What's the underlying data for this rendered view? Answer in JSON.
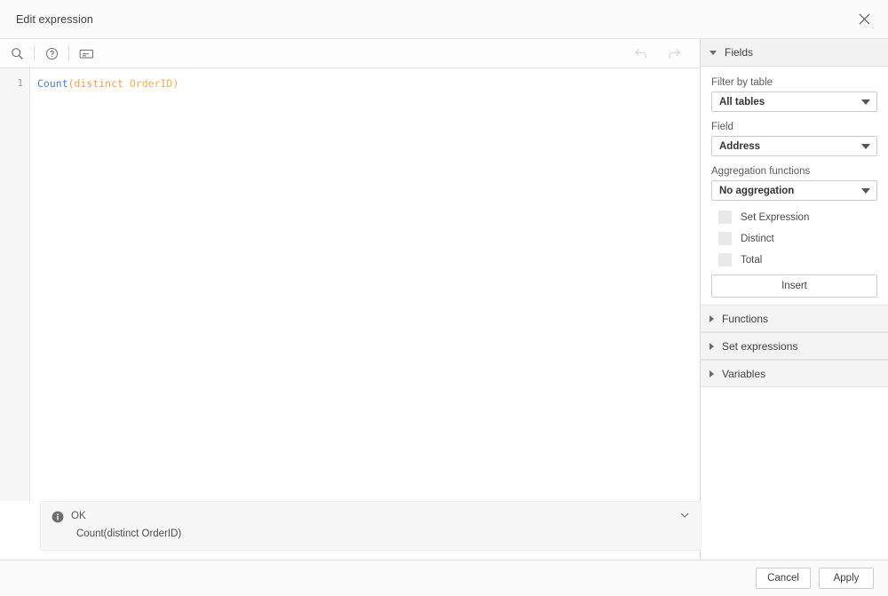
{
  "dialog": {
    "title": "Edit expression",
    "close_icon": "close-icon"
  },
  "toolbar": {
    "search_icon": "search-icon",
    "help_icon": "help-circle-icon",
    "expression_icon": "expression-box-icon",
    "undo_icon": "undo-arrow-icon",
    "redo_icon": "redo-arrow-icon"
  },
  "editor": {
    "line_number": "1",
    "tokens": {
      "func": "Count",
      "keyword": "(distinct",
      "field": " OrderID)"
    },
    "full_text": "Count(distinct OrderID)"
  },
  "status": {
    "icon": "info-icon",
    "title": "OK",
    "detail": "Count(distinct OrderID)",
    "chevron_icon": "chevron-down-icon"
  },
  "panel": {
    "fields_section": {
      "title": "Fields",
      "expanded": true,
      "filter_by_table_label": "Filter by table",
      "filter_by_table_value": "All tables",
      "field_label": "Field",
      "field_value": "Address",
      "aggregation_label": "Aggregation functions",
      "aggregation_value": "No aggregation",
      "checkboxes": [
        {
          "label": "Set Expression",
          "checked": false
        },
        {
          "label": "Distinct",
          "checked": false
        },
        {
          "label": "Total",
          "checked": false
        }
      ],
      "insert_label": "Insert"
    },
    "collapsed_sections": [
      {
        "title": "Functions"
      },
      {
        "title": "Set expressions"
      },
      {
        "title": "Variables"
      }
    ]
  },
  "footer": {
    "cancel_label": "Cancel",
    "apply_label": "Apply"
  }
}
